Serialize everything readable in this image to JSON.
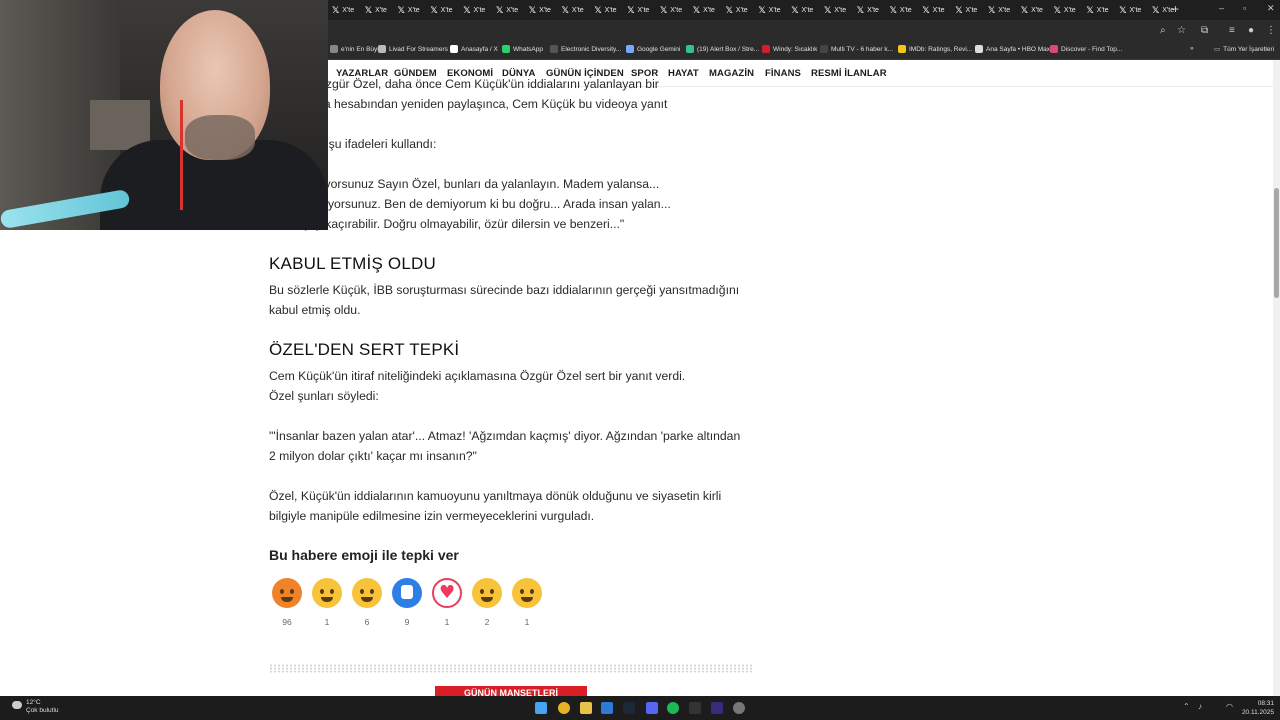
{
  "browser": {
    "tabs": [
      {
        "glyph": "𝕏",
        "label": "X'te"
      },
      {
        "glyph": "𝕏",
        "label": "X'te"
      },
      {
        "glyph": "𝕏",
        "label": "X'te"
      },
      {
        "glyph": "𝕏",
        "label": "X'te"
      },
      {
        "glyph": "𝕏",
        "label": "X'te"
      },
      {
        "glyph": "𝕏",
        "label": "X'te"
      },
      {
        "glyph": "𝕏",
        "label": "X'te"
      },
      {
        "glyph": "𝕏",
        "label": "X'te"
      },
      {
        "glyph": "𝕏",
        "label": "X'te"
      },
      {
        "glyph": "𝕏",
        "label": "X'te"
      },
      {
        "glyph": "𝕏",
        "label": "X'te"
      },
      {
        "glyph": "𝕏",
        "label": "X'te"
      },
      {
        "glyph": "𝕏",
        "label": "X'te"
      },
      {
        "glyph": "𝕏",
        "label": "X'te"
      },
      {
        "glyph": "𝕏",
        "label": "X'te"
      },
      {
        "glyph": "𝕏",
        "label": "X'te"
      },
      {
        "glyph": "𝕏",
        "label": "X'te"
      },
      {
        "glyph": "𝕏",
        "label": "X'te"
      },
      {
        "glyph": "𝕏",
        "label": "X'te"
      },
      {
        "glyph": "𝕏",
        "label": "X'te"
      },
      {
        "glyph": "𝕏",
        "label": "X'te"
      },
      {
        "glyph": "𝕏",
        "label": "X'te"
      },
      {
        "glyph": "𝕏",
        "label": "X'te"
      },
      {
        "glyph": "𝕏",
        "label": "X'te"
      },
      {
        "glyph": "𝕏",
        "label": "X'te"
      },
      {
        "glyph": "𝕏",
        "label": "X'te"
      }
    ],
    "new_tab": "+",
    "window_controls": [
      "–",
      "▫",
      "✕"
    ],
    "bookmarks": [
      {
        "label": "e'nin En Büyü...",
        "color": "#888888"
      },
      {
        "label": "Livad For Streamers",
        "color": "#bbbbbb"
      },
      {
        "label": "Anasayfa / X",
        "color": "#ffffff"
      },
      {
        "label": "WhatsApp",
        "color": "#25d366"
      },
      {
        "label": "Electronic Diversity...",
        "color": "#555555"
      },
      {
        "label": "Google Gemini",
        "color": "#7aa7ff"
      },
      {
        "label": "(19) Alert Box / Stre...",
        "color": "#31c48d"
      },
      {
        "label": "Windy: Sıcaklık",
        "color": "#d02030"
      },
      {
        "label": "Multi TV - 6 haber k...",
        "color": "#444444"
      },
      {
        "label": "IMDb: Ratings, Revi...",
        "color": "#f5c518"
      },
      {
        "label": "Ana Sayfa • HBO Max",
        "color": "#dddddd"
      },
      {
        "label": "Discover - Find Top...",
        "color": "#e0457b"
      }
    ],
    "bookmarks_more": "»",
    "all_bookmarks": "Tüm Yer İşaretleri"
  },
  "nav": {
    "items": [
      "YAZARLAR",
      "GÜNDEM",
      "EKONOMİ",
      "DÜNYA",
      "GÜNÜN İÇİNDEN",
      "SPOR",
      "HAYAT",
      "MAGAZİN",
      "FİNANS",
      "RESMİ İLANLAR"
    ]
  },
  "article": {
    "p_top1": "Başkanı Özgür Özel, daha önce Cem Küçük'ün iddialarını yalanlayan bir",
    "p_top2": "syal medya hesabından yeniden paylaşınca, Cem Küçük bu videoya yanıt",
    "p_top3": "lamasında şu ifadeleri kullandı:",
    "p_quote1": "em yalanlıyorsunuz Sayın Özel, bunları da yalanlayın. Madem yalansa...",
    "p_quote2": "tane yakalıyorsunuz. Ben de demiyorum ki bu doğru... Arada insan yalan...",
    "p_quote3": "an bir şey kaçırabilir. Doğru olmayabilir, özür dilersin ve benzeri...\"",
    "heading1": "KABUL ETMİŞ OLDU",
    "p1_line1": "Bu sözlerle Küçük, İBB soruşturması sürecinde bazı iddialarının gerçeği yansıtmadığını",
    "p1_line2": "kabul etmiş oldu.",
    "heading2": "ÖZEL'DEN SERT TEPKİ",
    "p2_line1": "Cem Küçük'ün itiraf niteliğindeki açıklamasına Özgür Özel sert bir yanıt verdi.",
    "p2_line2": "Özel şunları söyledi:",
    "p3_line1": "\"'İnsanlar bazen yalan atar'... Atmaz! 'Ağzımdan kaçmış' diyor. Ağzından 'parke altından",
    "p3_line2": "2 milyon dolar çıktı' kaçar mı insanın?\"",
    "p4_line1": "Özel, Küçük'ün iddialarının kamuoyunu yanıltmaya dönük olduğunu ve siyasetin kirli",
    "p4_line2": "bilgiyle manipüle edilmesine izin vermeyeceklerini vurguladı."
  },
  "reactions": {
    "title": "Bu habere emoji ile tepki ver",
    "items": [
      {
        "name": "angry",
        "count": "96",
        "color": "#f0822a"
      },
      {
        "name": "heart-eyes",
        "count": "1",
        "color": "#f7c33b"
      },
      {
        "name": "laughing",
        "count": "6",
        "color": "#f7c33b"
      },
      {
        "name": "like",
        "count": "9",
        "color": "#2d7fe3"
      },
      {
        "name": "heart",
        "count": "1",
        "color": "#ec3b5b"
      },
      {
        "name": "sad",
        "count": "2",
        "color": "#f7c33b"
      },
      {
        "name": "surprised",
        "count": "1",
        "color": "#f7c33b"
      }
    ]
  },
  "more_button": "GÜNÜN MANŞETLERİ",
  "taskbar": {
    "temp": "12°C",
    "weather": "Çok bulutlu",
    "time": "08:31",
    "date": "20.11.2025"
  }
}
